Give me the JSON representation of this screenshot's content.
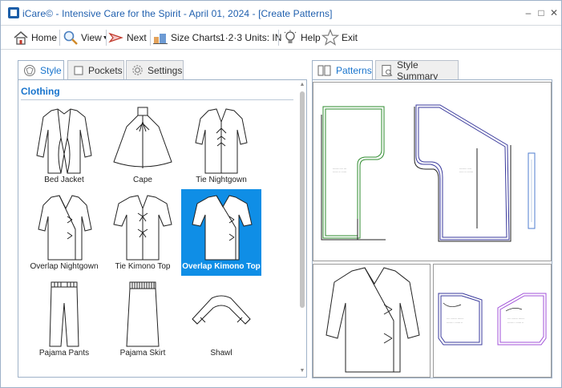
{
  "window": {
    "title": "iCare© - Intensive Care for the Spirit - April 01, 2024 - [Create Patterns]"
  },
  "toolbar": {
    "home": "Home",
    "view": "View",
    "next": "Next",
    "size_charts": "Size Charts",
    "units": "1·2·3 Units: IN",
    "help": "Help",
    "exit": "Exit"
  },
  "left_tabs": [
    "Style",
    "Pockets",
    "Settings"
  ],
  "right_tabs": [
    "Patterns",
    "Style Summary"
  ],
  "section": "Clothing",
  "styles": [
    {
      "label": "Bed Jacket",
      "icon": "bed-jacket-icon"
    },
    {
      "label": "Cape",
      "icon": "cape-icon"
    },
    {
      "label": "Tie Nightgown",
      "icon": "tie-nightgown-icon"
    },
    {
      "label": "Overlap Nightgown",
      "icon": "overlap-nightgown-icon"
    },
    {
      "label": "Tie Kimono Top",
      "icon": "tie-kimono-top-icon"
    },
    {
      "label": "Overlap Kimono Top",
      "icon": "overlap-kimono-top-icon",
      "selected": true
    },
    {
      "label": "Pajama Pants",
      "icon": "pajama-pants-icon"
    },
    {
      "label": "Pajama Skirt",
      "icon": "pajama-skirt-icon"
    },
    {
      "label": "Shawl",
      "icon": "shawl-icon"
    }
  ],
  "colors": {
    "accent": "#1874cd",
    "selected_bg": "#0f8ee6",
    "pattern_green": "#2e8b2e",
    "pattern_navy": "#3a3a9c",
    "pattern_blue": "#4f7ecf",
    "pattern_purple": "#a050d8"
  }
}
